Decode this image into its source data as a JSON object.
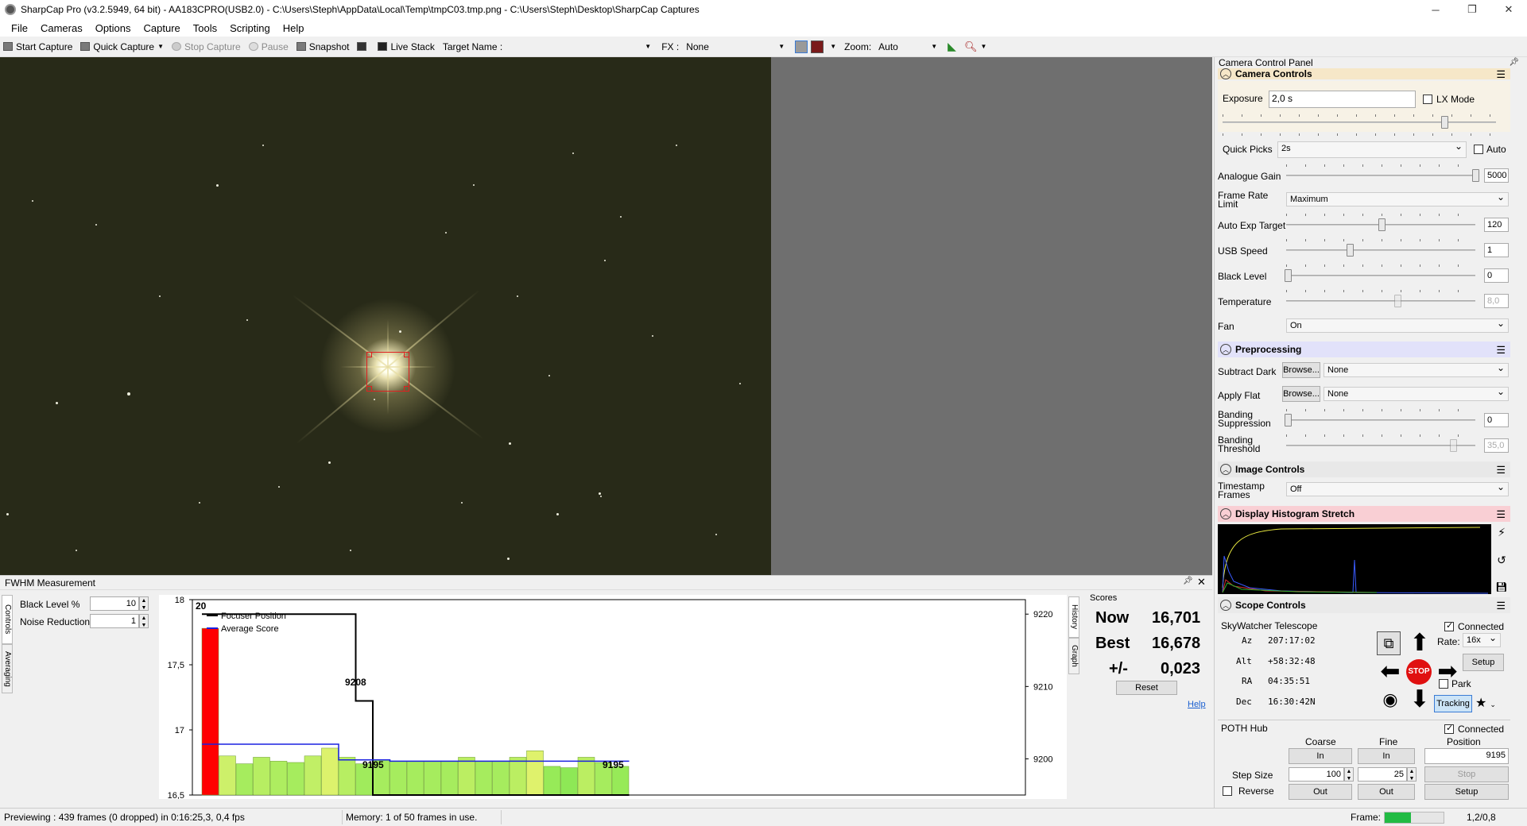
{
  "window": {
    "title": "SharpCap Pro (v3.2.5949, 64 bit) - AA183CPRO(USB2.0) - C:\\Users\\Steph\\AppData\\Local\\Temp\\tmpC03.tmp.png - C:\\Users\\Steph\\Desktop\\SharpCap Captures",
    "controls": {
      "minimize": "─",
      "maximize": "❐",
      "close": "✕"
    }
  },
  "menu": [
    "File",
    "Cameras",
    "Options",
    "Capture",
    "Tools",
    "Scripting",
    "Help"
  ],
  "toolbar": {
    "start_capture": "Start Capture",
    "quick_capture": "Quick Capture",
    "stop_capture": "Stop Capture",
    "pause": "Pause",
    "snapshot": "Snapshot",
    "live_stack": "Live Stack",
    "target_name_label": "Target Name :",
    "target_name_value": "",
    "fx_label": "FX :",
    "fx_value": "None",
    "zoom_label": "Zoom:",
    "zoom_value": "Auto"
  },
  "camera_panel": {
    "title": "Camera Control Panel",
    "camera_controls": {
      "header": "Camera Controls",
      "exposure_label": "Exposure",
      "exposure_value": "2,0 s",
      "lx_mode_label": "LX Mode",
      "quick_picks_label": "Quick Picks",
      "quick_picks_value": "2s",
      "auto_label": "Auto",
      "analogue_gain_label": "Analogue Gain",
      "analogue_gain_value": "5000",
      "frame_rate_limit_label": "Frame Rate Limit",
      "frame_rate_limit_value": "Maximum",
      "auto_exp_target_label": "Auto Exp Target",
      "auto_exp_target_value": "120",
      "usb_speed_label": "USB Speed",
      "usb_speed_value": "1",
      "black_level_label": "Black Level",
      "black_level_value": "0",
      "temperature_label": "Temperature",
      "temperature_value": "8,0",
      "fan_label": "Fan",
      "fan_value": "On"
    },
    "preprocessing": {
      "header": "Preprocessing",
      "subtract_dark_label": "Subtract Dark",
      "subtract_dark_value": "None",
      "apply_flat_label": "Apply Flat",
      "apply_flat_value": "None",
      "browse_label": "Browse...",
      "banding_suppression_label": "Banding Suppression",
      "banding_suppression_value": "0",
      "banding_threshold_label": "Banding Threshold",
      "banding_threshold_value": "35,0"
    },
    "image_controls": {
      "header": "Image Controls",
      "timestamp_frames_label": "Timestamp Frames",
      "timestamp_frames_value": "Off"
    },
    "histogram": {
      "header": "Display Histogram Stretch"
    },
    "scope_controls": {
      "header": "Scope Controls",
      "telescope_name": "SkyWatcher Telescope",
      "connected_label": "Connected",
      "az_label": "Az",
      "az_value": "207:17:02",
      "alt_label": "Alt",
      "alt_value": "+58:32:48",
      "ra_label": "RA",
      "ra_value": "04:35:51",
      "dec_label": "Dec",
      "dec_value": "16:30:42N",
      "rate_label": "Rate:",
      "rate_value": "16x",
      "setup_label": "Setup",
      "park_label": "Park",
      "tracking_label": "Tracking",
      "stop_label": "STOP"
    },
    "poth": {
      "title": "POTH Hub",
      "connected_label": "Connected",
      "coarse_label": "Coarse",
      "fine_label": "Fine",
      "position_label": "Position",
      "in_label": "In",
      "out_label": "Out",
      "position_value": "9195",
      "step_size_label": "Step Size",
      "coarse_step": "100",
      "fine_step": "25",
      "stop_label": "Stop",
      "setup_label": "Setup",
      "reverse_label": "Reverse"
    }
  },
  "fwhm": {
    "title": "FWHM Measurement",
    "side_tabs": [
      "Controls",
      "Averaging"
    ],
    "right_tabs": [
      "History",
      "Graph"
    ],
    "black_level_label": "Black Level %",
    "black_level_value": "10",
    "noise_reduction_label": "Noise Reduction",
    "noise_reduction_value": "1",
    "scores_label": "Scores",
    "now_label": "Now",
    "now_value": "16,701",
    "best_label": "Best",
    "best_value": "16,678",
    "pm_label": "+/-",
    "pm_value": "0,023",
    "reset_label": "Reset",
    "help_label": "Help"
  },
  "chart_data": {
    "type": "bar",
    "title": "",
    "ylim": [
      16.5,
      18
    ],
    "y_ticks": [
      "18",
      "17,5",
      "17",
      "16,5"
    ],
    "y2lim": [
      9195,
      9222
    ],
    "y2_ticks": [
      "9220",
      "9210",
      "9200"
    ],
    "legend": [
      "Focuser Position",
      "Average Score"
    ],
    "annotations": [
      "20",
      "9208",
      "9195",
      "9195"
    ],
    "values": [
      17.78,
      16.8,
      16.74,
      16.79,
      16.76,
      16.75,
      16.8,
      16.86,
      16.79,
      16.74,
      16.77,
      16.76,
      16.76,
      16.76,
      16.76,
      16.79,
      16.76,
      16.76,
      16.79,
      16.84,
      16.72,
      16.71,
      16.79,
      16.75,
      16.72
    ],
    "bar_colors": [
      "#ff0000",
      "#cdf06a",
      "#a6ec5e",
      "#b7ee62",
      "#aeed60",
      "#a6ec5e",
      "#c1ef66",
      "#dcf26c",
      "#b7ee62",
      "#a0eb5c",
      "#a6ec5e",
      "#a6ec5e",
      "#a6ec5e",
      "#a6ec5e",
      "#a6ec5e",
      "#bbee62",
      "#a6ec5e",
      "#a6ec5e",
      "#bbee62",
      "#dff26c",
      "#97ea58",
      "#8ee856",
      "#bbee62",
      "#a6ec5e",
      "#97ea58"
    ],
    "average_score": [
      16.89,
      16.89,
      16.89,
      16.89,
      16.89,
      16.89,
      16.89,
      16.89,
      16.77,
      16.77,
      16.77,
      16.76,
      16.76,
      16.76,
      16.76,
      16.76,
      16.76,
      16.76,
      16.76,
      16.76,
      16.76,
      16.76,
      16.76,
      16.76,
      16.76
    ],
    "focuser_position": [
      9220,
      9220,
      9220,
      9220,
      9220,
      9220,
      9220,
      9220,
      9220,
      9208,
      9195,
      9195,
      9195,
      9195,
      9195,
      9195,
      9195,
      9195,
      9195,
      9195,
      9195,
      9195,
      9195,
      9195,
      9195
    ]
  },
  "status": {
    "previewing": "Previewing : 439 frames (0 dropped) in 0:16:25,3, 0,4 fps",
    "memory": "Memory: 1 of 50 frames in use.",
    "frame_label": "Frame:",
    "frame_value": "1,2/0,8",
    "frame_fill": 0.45
  }
}
